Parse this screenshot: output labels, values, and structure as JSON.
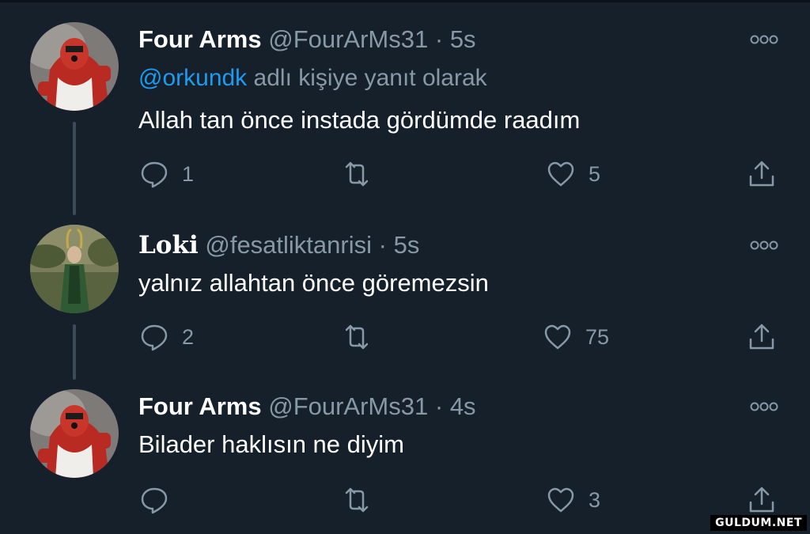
{
  "tweets": [
    {
      "name": "Four Arms",
      "handle": "@FourArMs31",
      "separator": "·",
      "time": "5s",
      "reply_prefix_mention": "@orkundk",
      "reply_suffix": "adlı kişiye yanıt olarak",
      "text": "Allah tan önce instada gördümde raadım",
      "replies": "1",
      "retweets": "",
      "likes": "5"
    },
    {
      "name": "Loki",
      "handle": "@fesatliktanrisi",
      "separator": "·",
      "time": "5s",
      "text": "yalnız allahtan önce göremezsin",
      "replies": "2",
      "retweets": "",
      "likes": "75"
    },
    {
      "name": "Four Arms",
      "handle": "@FourArMs31",
      "separator": "·",
      "time": "4s",
      "text": "Bilader haklısın ne diyim",
      "replies": "",
      "retweets": "",
      "likes": "3"
    }
  ],
  "icons": {
    "reply": "reply-icon",
    "retweet": "retweet-icon",
    "like": "heart-icon",
    "share": "share-icon",
    "more": "more-icon"
  },
  "colors": {
    "background": "#15202b",
    "muted": "#8899a6",
    "link": "#1d9bf0"
  },
  "watermark": "GULDUM.NET"
}
